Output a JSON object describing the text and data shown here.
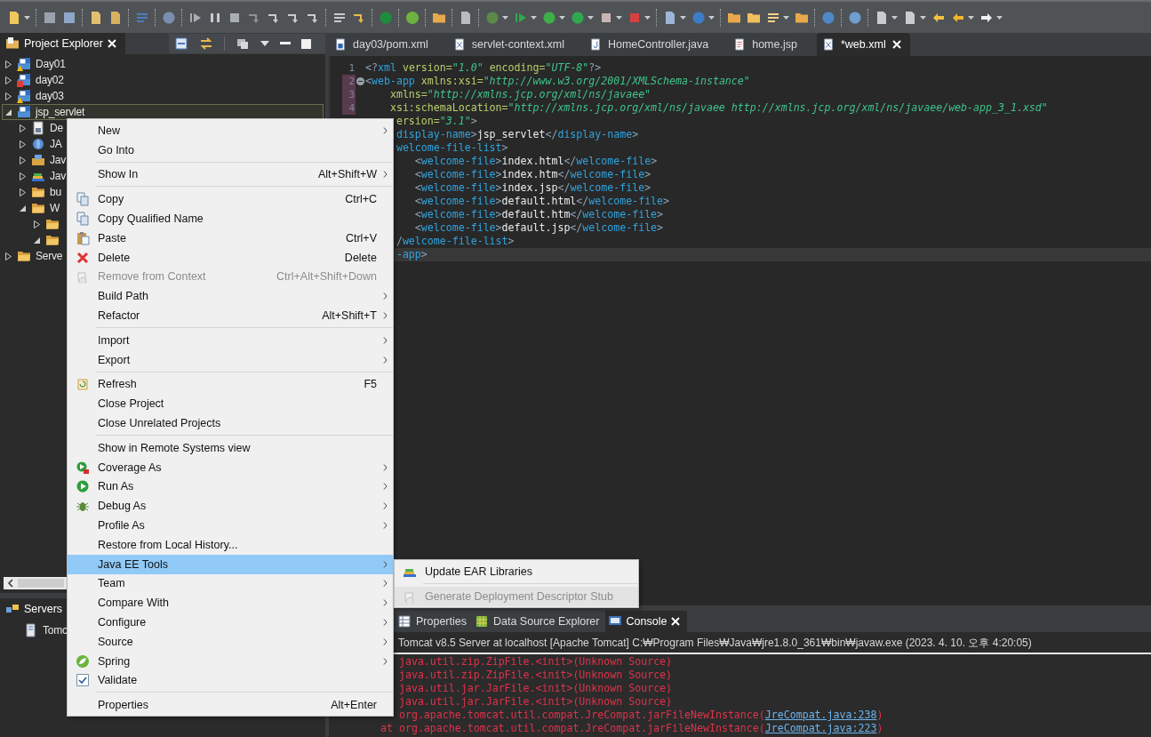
{
  "project_explorer": {
    "title": "Project Explorer",
    "selected": true,
    "items": [
      {
        "label": "Day01",
        "kind": "project",
        "warning": true,
        "error": false,
        "expanded": false,
        "selected": false
      },
      {
        "label": "day02",
        "kind": "project",
        "warning": false,
        "error": true,
        "expanded": false,
        "selected": false
      },
      {
        "label": "day03",
        "kind": "project",
        "warning": true,
        "error": false,
        "expanded": false,
        "selected": false
      },
      {
        "label": "jsp_servlet",
        "kind": "project",
        "warning": false,
        "error": false,
        "expanded": true,
        "selected": true,
        "children": [
          {
            "label": "De",
            "kind": "descriptor",
            "expanded": false,
            "selected": false
          },
          {
            "label": "JA",
            "kind": "webservice",
            "expanded": false,
            "selected": false
          },
          {
            "label": "Jav",
            "kind": "resources",
            "expanded": false,
            "selected": false
          },
          {
            "label": "Jav",
            "kind": "library",
            "expanded": false,
            "selected": false
          },
          {
            "label": "bu",
            "kind": "folder",
            "expanded": false,
            "selected": false
          },
          {
            "label": "W",
            "kind": "folder",
            "expanded": true,
            "selected": false,
            "children": [
              {
                "kind": "folder",
                "expanded": false,
                "selected": false
              },
              {
                "kind": "folder",
                "expanded": true,
                "selected": false
              }
            ]
          }
        ]
      },
      {
        "label": "Serve",
        "kind": "folder",
        "warning": false,
        "error": false,
        "expanded": false,
        "selected": false
      }
    ]
  },
  "servers_view": {
    "title": "Servers",
    "selected": true,
    "items": [
      {
        "label": "Tomc"
      }
    ]
  },
  "editor": {
    "tabs": [
      {
        "label": "day03/pom.xml",
        "kind": "maven",
        "selected": false
      },
      {
        "label": "servlet-context.xml",
        "kind": "xml",
        "selected": false
      },
      {
        "label": "HomeController.java",
        "kind": "java",
        "selected": false
      },
      {
        "label": "home.jsp",
        "kind": "jsp",
        "selected": false
      },
      {
        "label": "*web.xml",
        "kind": "xml",
        "selected": true
      }
    ],
    "lines": [
      {
        "number": "1",
        "changed": false,
        "foldable": false,
        "current": false,
        "segments": [
          {
            "kind": "punct",
            "text": "<?"
          },
          {
            "kind": "tag",
            "text": "xml"
          },
          {
            "kind": "attr",
            "text": " version="
          },
          {
            "kind": "string",
            "text": "\"1.0\""
          },
          {
            "kind": "attr",
            "text": " encoding="
          },
          {
            "kind": "string",
            "text": "\"UTF-8\""
          },
          {
            "kind": "punct",
            "text": "?>"
          }
        ]
      },
      {
        "number": "2",
        "changed": true,
        "foldable": true,
        "current": false,
        "segments": [
          {
            "kind": "punct",
            "text": "<"
          },
          {
            "kind": "tag",
            "text": "web-app"
          },
          {
            "kind": "attr",
            "text": " xmlns:xsi="
          },
          {
            "kind": "string",
            "text": "\"http://www.w3.org/2001/XMLSchema-instance\""
          }
        ]
      },
      {
        "number": "3",
        "changed": true,
        "foldable": false,
        "current": false,
        "segments": [
          {
            "kind": "attr",
            "text": "    xmlns="
          },
          {
            "kind": "string",
            "text": "\"http://xmlns.jcp.org/xml/ns/javaee\""
          }
        ]
      },
      {
        "number": "4",
        "changed": true,
        "foldable": false,
        "current": false,
        "segments": [
          {
            "kind": "attr",
            "text": "    xsi:schemaLocation="
          },
          {
            "kind": "string",
            "text": "\"http://xmlns.jcp.org/xml/ns/javaee http://xmlns.jcp.org/xml/ns/javaee/web-app_3_1.xsd\""
          }
        ]
      },
      {
        "current": false,
        "segments": [
          {
            "kind": "attr",
            "text": "     ersion="
          },
          {
            "kind": "string",
            "text": "\"3.1\""
          },
          {
            "kind": "punct",
            "text": ">"
          }
        ]
      },
      {
        "current": false,
        "segments": [
          {
            "kind": "tag",
            "text": "     display-name"
          },
          {
            "kind": "punct",
            "text": ">"
          },
          {
            "kind": "text",
            "text": "jsp_servlet"
          },
          {
            "kind": "punct",
            "text": "</"
          },
          {
            "kind": "tag",
            "text": "display-name"
          },
          {
            "kind": "punct",
            "text": ">"
          }
        ]
      },
      {
        "current": false,
        "segments": [
          {
            "kind": "tag",
            "text": "     welcome-file-list"
          },
          {
            "kind": "punct",
            "text": ">"
          }
        ]
      },
      {
        "current": false,
        "segments": [
          {
            "kind": "punct",
            "text": "        <"
          },
          {
            "kind": "tag",
            "text": "welcome-file"
          },
          {
            "kind": "punct",
            "text": ">"
          },
          {
            "kind": "text",
            "text": "index.html"
          },
          {
            "kind": "punct",
            "text": "</"
          },
          {
            "kind": "tag",
            "text": "welcome-file"
          },
          {
            "kind": "punct",
            "text": ">"
          }
        ]
      },
      {
        "current": false,
        "segments": [
          {
            "kind": "punct",
            "text": "        <"
          },
          {
            "kind": "tag",
            "text": "welcome-file"
          },
          {
            "kind": "punct",
            "text": ">"
          },
          {
            "kind": "text",
            "text": "index.htm"
          },
          {
            "kind": "punct",
            "text": "</"
          },
          {
            "kind": "tag",
            "text": "welcome-file"
          },
          {
            "kind": "punct",
            "text": ">"
          }
        ]
      },
      {
        "current": false,
        "segments": [
          {
            "kind": "punct",
            "text": "        <"
          },
          {
            "kind": "tag",
            "text": "welcome-file"
          },
          {
            "kind": "punct",
            "text": ">"
          },
          {
            "kind": "text",
            "text": "index.jsp"
          },
          {
            "kind": "punct",
            "text": "</"
          },
          {
            "kind": "tag",
            "text": "welcome-file"
          },
          {
            "kind": "punct",
            "text": ">"
          }
        ]
      },
      {
        "current": false,
        "segments": [
          {
            "kind": "punct",
            "text": "        <"
          },
          {
            "kind": "tag",
            "text": "welcome-file"
          },
          {
            "kind": "punct",
            "text": ">"
          },
          {
            "kind": "text",
            "text": "default.html"
          },
          {
            "kind": "punct",
            "text": "</"
          },
          {
            "kind": "tag",
            "text": "welcome-file"
          },
          {
            "kind": "punct",
            "text": ">"
          }
        ]
      },
      {
        "current": false,
        "segments": [
          {
            "kind": "punct",
            "text": "        <"
          },
          {
            "kind": "tag",
            "text": "welcome-file"
          },
          {
            "kind": "punct",
            "text": ">"
          },
          {
            "kind": "text",
            "text": "default.htm"
          },
          {
            "kind": "punct",
            "text": "</"
          },
          {
            "kind": "tag",
            "text": "welcome-file"
          },
          {
            "kind": "punct",
            "text": ">"
          }
        ]
      },
      {
        "current": false,
        "segments": [
          {
            "kind": "punct",
            "text": "        <"
          },
          {
            "kind": "tag",
            "text": "welcome-file"
          },
          {
            "kind": "punct",
            "text": ">"
          },
          {
            "kind": "text",
            "text": "default.jsp"
          },
          {
            "kind": "punct",
            "text": "</"
          },
          {
            "kind": "tag",
            "text": "welcome-file"
          },
          {
            "kind": "punct",
            "text": ">"
          }
        ]
      },
      {
        "current": false,
        "segments": [
          {
            "kind": "punct",
            "text": "     /"
          },
          {
            "kind": "tag",
            "text": "welcome-file-list"
          },
          {
            "kind": "punct",
            "text": ">"
          }
        ]
      },
      {
        "current": true,
        "segments": [
          {
            "kind": "tag",
            "text": "     -app"
          },
          {
            "kind": "punct",
            "text": ">"
          }
        ]
      }
    ]
  },
  "console_view": {
    "tabs": [
      {
        "label": "Properties",
        "kind": "properties",
        "selected": false
      },
      {
        "label": "Data Source Explorer",
        "kind": "datasource",
        "selected": false
      },
      {
        "label": "Console",
        "kind": "console",
        "selected": true
      }
    ],
    "process": "Tomcat v8.5 Server at localhost [Apache Tomcat] C:₩Program Files₩Java₩jre1.8.0_361₩bin₩javaw.exe (2023. 4. 10. 오후 4:20:05)",
    "lines": [
      {
        "text": "   java.util.zip.ZipFile.<init>(Unknown Source)"
      },
      {
        "text": "   java.util.zip.ZipFile.<init>(Unknown Source)"
      },
      {
        "text": "   java.util.jar.JarFile.<init>(Unknown Source)"
      },
      {
        "text": "   java.util.jar.JarFile.<init>(Unknown Source)"
      },
      {
        "text": "   org.apache.tomcat.util.compat.JreCompat.jarFileNewInstance(",
        "link": "JreCompat.java:238",
        "tail": ")"
      },
      {
        "text": "at org.apache.tomcat.util.compat.JreCompat.jarFileNewInstance(",
        "link": "JreCompat.java:223",
        "tail": ")"
      }
    ]
  },
  "context_menu": {
    "items": [
      {
        "kind": "item",
        "label": "New",
        "submenu": true,
        "disabled": false,
        "selected": false
      },
      {
        "kind": "item",
        "label": "Go Into",
        "submenu": false,
        "disabled": false,
        "selected": false
      },
      {
        "kind": "separator"
      },
      {
        "kind": "item",
        "label": "Show In",
        "shortcut": "Alt+Shift+W",
        "submenu": true,
        "disabled": false,
        "selected": false
      },
      {
        "kind": "separator"
      },
      {
        "kind": "copy",
        "label": "Copy",
        "shortcut": "Ctrl+C",
        "submenu": false,
        "disabled": false,
        "selected": false
      },
      {
        "kind": "copy",
        "label": "Copy Qualified Name",
        "submenu": false,
        "disabled": false,
        "selected": false
      },
      {
        "kind": "paste",
        "label": "Paste",
        "shortcut": "Ctrl+V",
        "submenu": false,
        "disabled": false,
        "selected": false
      },
      {
        "kind": "delete",
        "label": "Delete",
        "shortcut": "Delete",
        "submenu": false,
        "disabled": false,
        "selected": false
      },
      {
        "kind": "remove",
        "label": "Remove from Context",
        "shortcut": "Ctrl+Alt+Shift+Down",
        "submenu": false,
        "disabled": true,
        "selected": false
      },
      {
        "kind": "item",
        "label": "Build Path",
        "submenu": true,
        "disabled": false,
        "selected": false
      },
      {
        "kind": "item",
        "label": "Refactor",
        "shortcut": "Alt+Shift+T",
        "submenu": true,
        "disabled": false,
        "selected": false
      },
      {
        "kind": "separator"
      },
      {
        "kind": "item",
        "label": "Import",
        "submenu": true,
        "disabled": false,
        "selected": false
      },
      {
        "kind": "item",
        "label": "Export",
        "submenu": true,
        "disabled": false,
        "selected": false
      },
      {
        "kind": "separator"
      },
      {
        "kind": "refresh",
        "label": "Refresh",
        "shortcut": "F5",
        "submenu": false,
        "disabled": false,
        "selected": false
      },
      {
        "kind": "item",
        "label": "Close Project",
        "submenu": false,
        "disabled": false,
        "selected": false
      },
      {
        "kind": "item",
        "label": "Close Unrelated Projects",
        "submenu": false,
        "disabled": false,
        "selected": false
      },
      {
        "kind": "separator"
      },
      {
        "kind": "item",
        "label": "Show in Remote Systems view",
        "submenu": false,
        "disabled": false,
        "selected": false
      },
      {
        "kind": "coverage",
        "label": "Coverage As",
        "submenu": true,
        "disabled": false,
        "selected": false
      },
      {
        "kind": "run",
        "label": "Run As",
        "submenu": true,
        "disabled": false,
        "selected": false
      },
      {
        "kind": "debug",
        "label": "Debug As",
        "submenu": true,
        "disabled": false,
        "selected": false
      },
      {
        "kind": "item",
        "label": "Profile As",
        "submenu": true,
        "disabled": false,
        "selected": false
      },
      {
        "kind": "item",
        "label": "Restore from Local History...",
        "submenu": false,
        "disabled": false,
        "selected": false
      },
      {
        "kind": "item",
        "label": "Java EE Tools",
        "submenu": true,
        "disabled": false,
        "selected": true
      },
      {
        "kind": "item",
        "label": "Team",
        "submenu": true,
        "disabled": false,
        "selected": false
      },
      {
        "kind": "item",
        "label": "Compare With",
        "submenu": true,
        "disabled": false,
        "selected": false
      },
      {
        "kind": "item",
        "label": "Configure",
        "submenu": true,
        "disabled": false,
        "selected": false
      },
      {
        "kind": "item",
        "label": "Source",
        "submenu": true,
        "disabled": false,
        "selected": false
      },
      {
        "kind": "spring",
        "label": "Spring",
        "submenu": true,
        "disabled": false,
        "selected": false
      },
      {
        "kind": "check",
        "label": "Validate",
        "checked": true,
        "submenu": false,
        "disabled": false,
        "selected": false
      },
      {
        "kind": "separator"
      },
      {
        "kind": "item",
        "label": "Properties",
        "shortcut": "Alt+Enter",
        "submenu": false,
        "disabled": false,
        "selected": false
      }
    ]
  },
  "submenu": {
    "items": [
      {
        "kind": "library",
        "label": "Update EAR Libraries",
        "disabled": false,
        "selected": false
      },
      {
        "kind": "separator"
      },
      {
        "kind": "remove",
        "label": "Generate Deployment Descriptor Stub",
        "disabled": true,
        "selected": true
      }
    ]
  }
}
